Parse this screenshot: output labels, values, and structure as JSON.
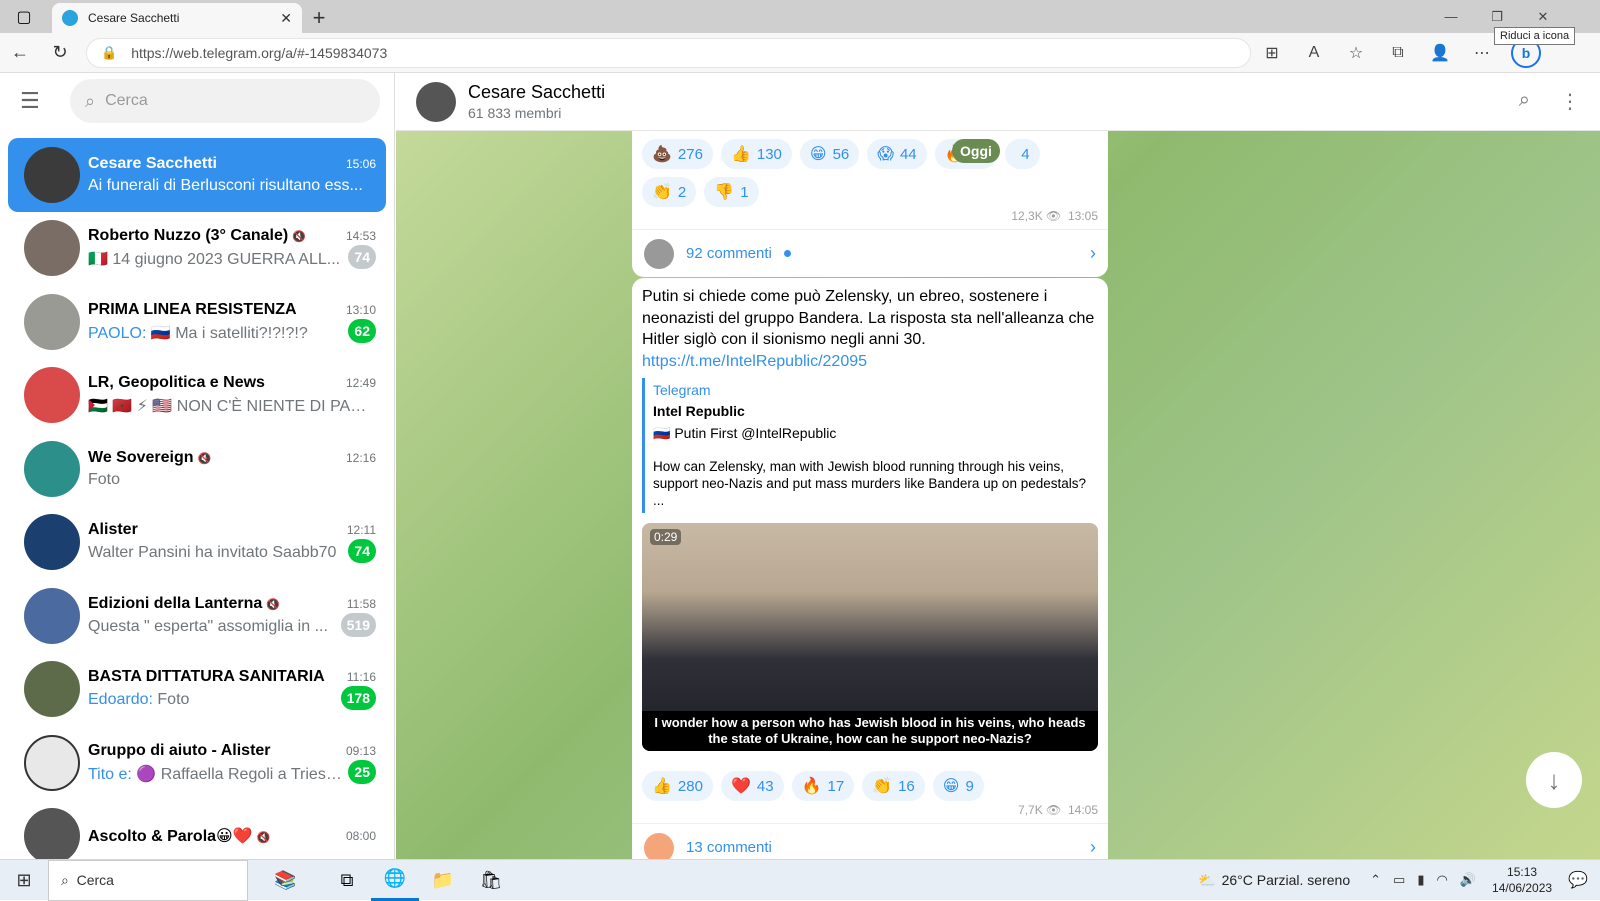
{
  "browser": {
    "tab_title": "Cesare Sacchetti",
    "url": "https://web.telegram.org/a/#-1459834073",
    "tooltip": "Riduci a icona"
  },
  "sidebar": {
    "search_placeholder": "Cerca",
    "chats": [
      {
        "name": "Cesare Sacchetti",
        "time": "15:06",
        "preview": "Ai funerali di Berlusconi risultano ess...",
        "sender": "",
        "badge": "",
        "active": true
      },
      {
        "name": "Roberto Nuzzo (3° Canale)",
        "time": "14:53",
        "preview": "🇮🇹 14 giugno 2023 GUERRA ALL...",
        "sender": "",
        "badge": "74",
        "active": false
      },
      {
        "name": "PRIMA LINEA RESISTENZA",
        "time": "13:10",
        "preview": "🇷🇺 Ma i satelliti?!?!?!?",
        "sender": "PAOLO:",
        "badge": "62",
        "active": false
      },
      {
        "name": "LR, Geopolitica e News",
        "time": "12:49",
        "preview": "🇵🇸 🇲🇦 ⚡ 🇺🇸 NON C'È NIENTE DI PACIFI...",
        "sender": "",
        "badge": "",
        "active": false
      },
      {
        "name": "We Sovereign",
        "time": "12:16",
        "preview": "Foto",
        "sender": "",
        "badge": "",
        "active": false
      },
      {
        "name": "Alister",
        "time": "12:11",
        "preview": "Walter Pansini ha invitato Saabb70",
        "sender": "",
        "badge": "74",
        "active": false
      },
      {
        "name": "Edizioni della Lanterna",
        "time": "11:58",
        "preview": "Questa \" esperta\" assomiglia in ...",
        "sender": "",
        "badge": "519",
        "active": false
      },
      {
        "name": "BASTA DITTATURA SANITARIA",
        "time": "11:16",
        "preview": "Foto",
        "sender": "Edoardo:",
        "badge": "178",
        "active": false
      },
      {
        "name": "Gruppo di aiuto - Alister",
        "time": "09:13",
        "preview": "🟣 Raffaella Regoli a Triest...",
        "sender": "Tito e:",
        "badge": "25",
        "active": false
      },
      {
        "name": "Ascolto & Parola😀❤️",
        "time": "08:00",
        "preview": "",
        "sender": "",
        "badge": "",
        "active": false
      }
    ]
  },
  "header": {
    "title": "Cesare Sacchetti",
    "subtitle": "61 833 membri"
  },
  "msg1": {
    "reactions": [
      {
        "emoji": "💩",
        "count": "276"
      },
      {
        "emoji": "👍",
        "count": "130"
      },
      {
        "emoji": "😁",
        "count": "56"
      },
      {
        "emoji": "😱",
        "count": "44"
      },
      {
        "emoji": "🔥",
        "count": "17"
      },
      {
        "emoji": "",
        "count": "4"
      },
      {
        "emoji": "👏",
        "count": "2"
      },
      {
        "emoji": "👎",
        "count": "1"
      }
    ],
    "views": "12,3K",
    "time": "13:05",
    "comments": "92 commenti"
  },
  "date_chip": "Oggi",
  "msg2": {
    "text": "Putin si chiede come può Zelensky, un ebreo, sostenere i neonazisti del gruppo Bandera. La risposta sta nell'alleanza che Hitler siglò con il sionismo negli anni 30.",
    "link": "https://t.me/IntelRepublic/22095",
    "preview_site": "Telegram",
    "preview_title": "Intel Republic",
    "preview_line": "🇷🇺 Putin First @IntelRepublic",
    "preview_desc": "How can Zelensky, man with Jewish blood running through his veins, support neo-Nazis and put mass murders like Bandera up on pedestals? ...",
    "video_time": "0:29",
    "video_subtitle": "I wonder how a person who has Jewish blood in his veins, who heads the state of Ukraine, how can he support neo-Nazis?",
    "reactions": [
      {
        "emoji": "👍",
        "count": "280"
      },
      {
        "emoji": "❤️",
        "count": "43"
      },
      {
        "emoji": "🔥",
        "count": "17"
      },
      {
        "emoji": "👏",
        "count": "16"
      },
      {
        "emoji": "😁",
        "count": "9"
      }
    ],
    "views": "7,7K",
    "time": "14:05",
    "comments": "13 commenti"
  },
  "taskbar": {
    "search": "Cerca",
    "weather": "26°C  Parzial. sereno",
    "time": "15:13",
    "date": "14/06/2023"
  }
}
